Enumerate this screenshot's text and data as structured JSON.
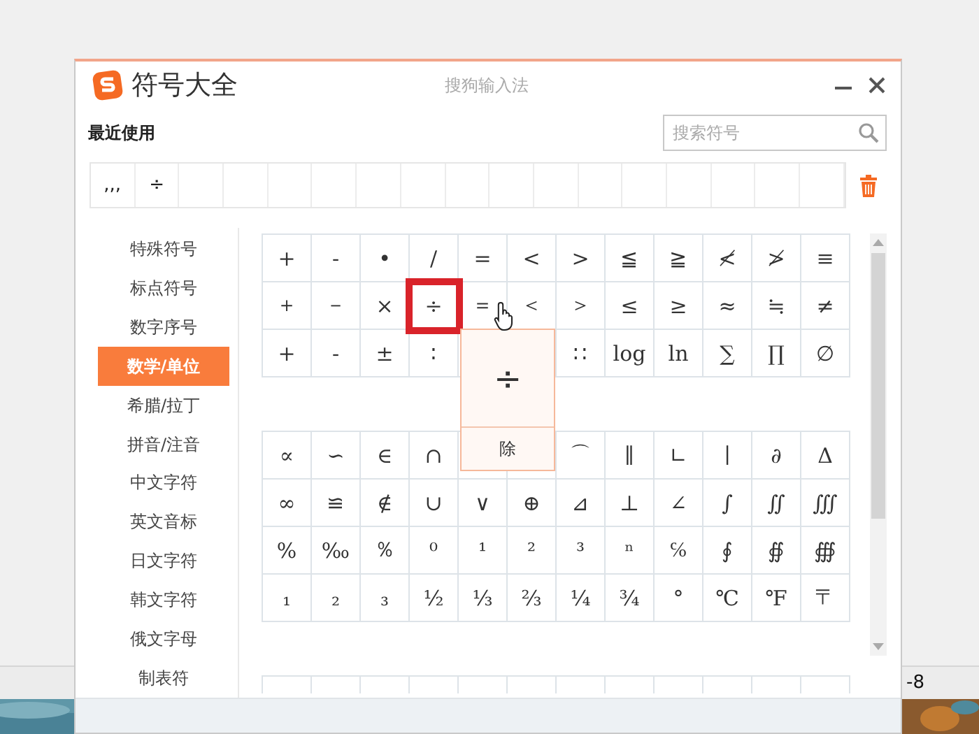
{
  "window": {
    "title": "符号大全",
    "app_name": "搜狗输入法"
  },
  "recent": {
    "label": "最近使用",
    "symbols": [
      ",,,",
      "÷"
    ]
  },
  "search": {
    "placeholder": "搜索符号"
  },
  "sidebar": {
    "items": [
      {
        "label": "特殊符号",
        "selected": false
      },
      {
        "label": "标点符号",
        "selected": false
      },
      {
        "label": "数字序号",
        "selected": false
      },
      {
        "label": "数学/单位",
        "selected": true
      },
      {
        "label": "希腊/拉丁",
        "selected": false
      },
      {
        "label": "拼音/注音",
        "selected": false
      },
      {
        "label": "中文字符",
        "selected": false
      },
      {
        "label": "英文音标",
        "selected": false
      },
      {
        "label": "日文字符",
        "selected": false
      },
      {
        "label": "韩文字符",
        "selected": false
      },
      {
        "label": "俄文字母",
        "selected": false
      },
      {
        "label": "制表符",
        "selected": false
      }
    ]
  },
  "blocks": [
    {
      "rows": [
        [
          {
            "symbol": "+",
            "selected": false
          },
          {
            "symbol": "-",
            "selected": false
          },
          {
            "symbol": "•",
            "selected": false
          },
          {
            "symbol": "/",
            "selected": false
          },
          {
            "symbol": "=",
            "selected": false
          },
          {
            "symbol": "<",
            "selected": false
          },
          {
            "symbol": ">",
            "selected": false
          },
          {
            "symbol": "≦",
            "selected": false
          },
          {
            "symbol": "≧",
            "selected": false
          },
          {
            "symbol": "≮",
            "selected": false
          },
          {
            "symbol": "≯",
            "selected": false
          },
          {
            "symbol": "≡",
            "selected": false
          }
        ],
        [
          {
            "symbol": "＋",
            "selected": false
          },
          {
            "symbol": "－",
            "selected": false
          },
          {
            "symbol": "×",
            "selected": false
          },
          {
            "symbol": "÷",
            "selected": true
          },
          {
            "symbol": "＝",
            "selected": false
          },
          {
            "symbol": "＜",
            "selected": false
          },
          {
            "symbol": "＞",
            "selected": false
          },
          {
            "symbol": "≤",
            "selected": false
          },
          {
            "symbol": "≥",
            "selected": false
          },
          {
            "symbol": "≈",
            "selected": false
          },
          {
            "symbol": "≒",
            "selected": false
          },
          {
            "symbol": "≠",
            "selected": false
          }
        ],
        [
          {
            "symbol": "+",
            "selected": false
          },
          {
            "symbol": "-",
            "selected": false
          },
          {
            "symbol": "±",
            "selected": false
          },
          {
            "symbol": "∶",
            "selected": false
          },
          {},
          {},
          {
            "symbol": "∷",
            "selected": false
          },
          {
            "symbol": "log",
            "selected": false
          },
          {
            "symbol": "ln",
            "selected": false
          },
          {
            "symbol": "∑",
            "selected": false
          },
          {
            "symbol": "∏",
            "selected": false
          },
          {
            "symbol": "∅",
            "selected": false
          }
        ]
      ]
    },
    {
      "rows": [
        [
          {
            "symbol": "∝",
            "selected": false
          },
          {
            "symbol": "∽",
            "selected": false
          },
          {
            "symbol": "∈",
            "selected": false
          },
          {
            "symbol": "∩",
            "selected": false
          },
          {},
          {},
          {
            "symbol": "⌒",
            "selected": false
          },
          {
            "symbol": "∥",
            "selected": false
          },
          {
            "symbol": "∟",
            "selected": false
          },
          {
            "symbol": "∣",
            "selected": false
          },
          {
            "symbol": "∂",
            "selected": false
          },
          {
            "symbol": "Δ",
            "selected": false
          }
        ],
        [
          {
            "symbol": "∞",
            "selected": false
          },
          {
            "symbol": "≌",
            "selected": false
          },
          {
            "symbol": "∉",
            "selected": false
          },
          {
            "symbol": "∪",
            "selected": false
          },
          {
            "symbol": "∨",
            "selected": false
          },
          {
            "symbol": "⊕",
            "selected": false
          },
          {
            "symbol": "⊿",
            "selected": false
          },
          {
            "symbol": "⊥",
            "selected": false
          },
          {
            "symbol": "∠",
            "selected": false
          },
          {
            "symbol": "∫",
            "selected": false
          },
          {
            "symbol": "∬",
            "selected": false
          },
          {
            "symbol": "∭",
            "selected": false
          }
        ],
        [
          {
            "symbol": "%",
            "selected": false
          },
          {
            "symbol": "‰",
            "selected": false
          },
          {
            "symbol": "％",
            "selected": false
          },
          {
            "symbol": "⁰",
            "selected": false
          },
          {
            "symbol": "¹",
            "selected": false
          },
          {
            "symbol": "²",
            "selected": false
          },
          {
            "symbol": "³",
            "selected": false
          },
          {
            "symbol": "ⁿ",
            "selected": false
          },
          {
            "symbol": "℅",
            "selected": false
          },
          {
            "symbol": "∮",
            "selected": false
          },
          {
            "symbol": "∯",
            "selected": false
          },
          {
            "symbol": "∰",
            "selected": false
          }
        ],
        [
          {
            "symbol": "₁",
            "selected": false
          },
          {
            "symbol": "₂",
            "selected": false
          },
          {
            "symbol": "₃",
            "selected": false
          },
          {
            "symbol": "½",
            "selected": false
          },
          {
            "symbol": "⅓",
            "selected": false
          },
          {
            "symbol": "⅔",
            "selected": false
          },
          {
            "symbol": "¼",
            "selected": false
          },
          {
            "symbol": "¾",
            "selected": false
          },
          {
            "symbol": "°",
            "selected": false
          },
          {
            "symbol": "℃",
            "selected": false
          },
          {
            "symbol": "℉",
            "selected": false
          },
          {
            "symbol": "〒",
            "selected": false
          }
        ]
      ]
    }
  ],
  "tooltip": {
    "symbol": "÷",
    "name": "除"
  },
  "desktop": {
    "label": "-8"
  }
}
